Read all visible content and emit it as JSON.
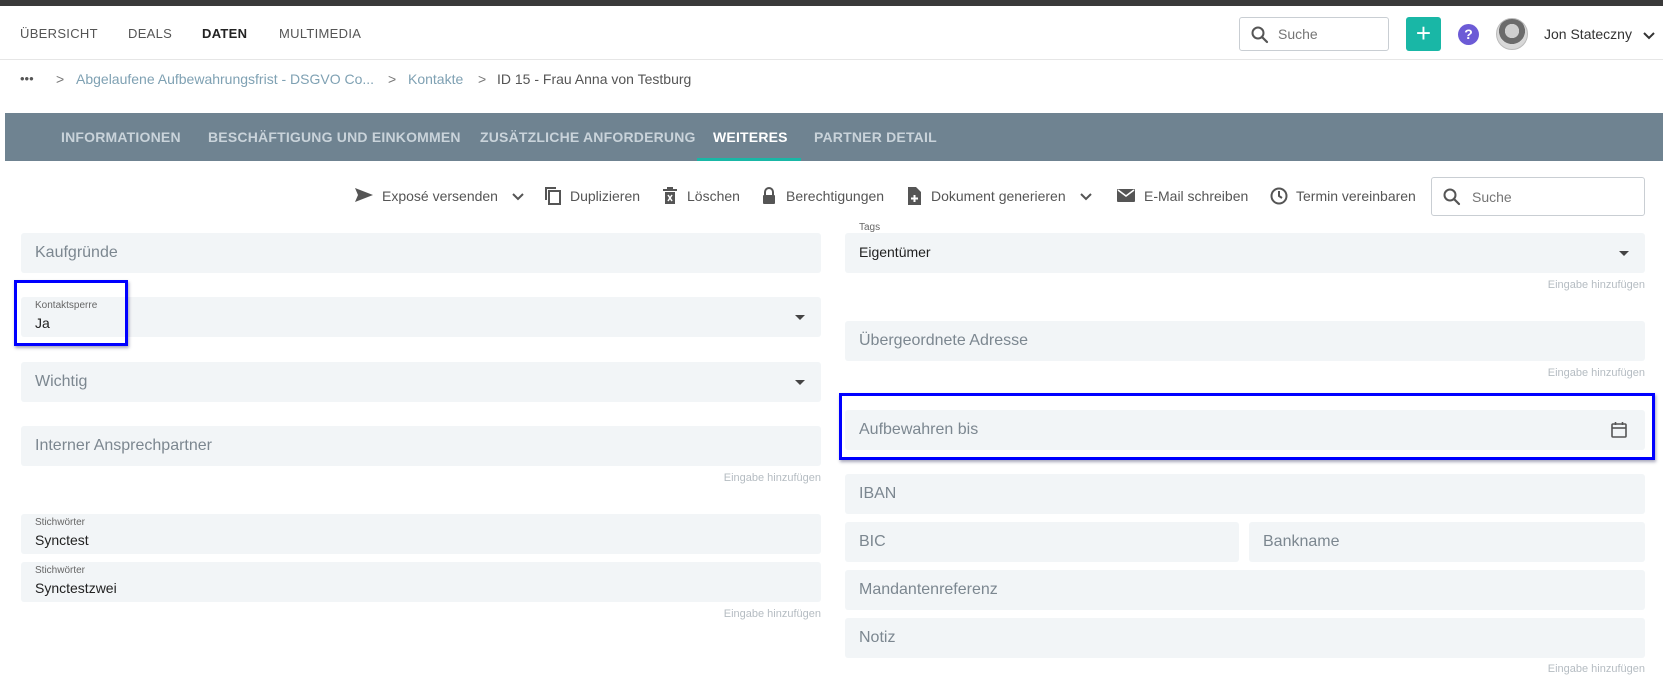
{
  "nav": {
    "items": [
      "ÜBERSICHT",
      "DEALS",
      "DATEN",
      "MULTIMEDIA"
    ],
    "active": "DATEN",
    "search_placeholder": "Suche",
    "add_label": "+",
    "help_label": "?",
    "user_name": "Jon Stateczny"
  },
  "breadcrumb": {
    "more": "•••",
    "sep": ">",
    "items": [
      "Abgelaufene Aufbewahrungsfrist - DSGVO Co...",
      "Kontakte"
    ],
    "current": "ID 15 - Frau Anna von Testburg"
  },
  "tabs": [
    "INFORMATIONEN",
    "BESCHÄFTIGUNG UND EINKOMMEN",
    "ZUSÄTZLICHE ANFORDERUNG",
    "WEITERES",
    "PARTNER DETAIL"
  ],
  "active_tab": "WEITERES",
  "actions": {
    "expose": "Exposé versenden",
    "duplicate": "Duplizieren",
    "delete": "Löschen",
    "permissions": "Berechtigungen",
    "generate_doc": "Dokument generieren",
    "email": "E-Mail schreiben",
    "appointment": "Termin vereinbaren",
    "search_placeholder": "Suche"
  },
  "left_fields": {
    "kaufgruende": "Kaufgründe",
    "kontaktsperre_label": "Kontaktsperre",
    "kontaktsperre_value": "Ja",
    "wichtig": "Wichtig",
    "ansprechpartner": "Interner Ansprechpartner",
    "hint": "Eingabe hinzufügen",
    "keywords_label": "Stichwörter",
    "keywords": [
      "Synctest",
      "Synctestzwei"
    ]
  },
  "right_fields": {
    "tags_label": "Tags",
    "tags_value": "Eigentümer",
    "parent_address": "Übergeordnete Adresse",
    "keep_until": "Aufbewahren bis",
    "iban": "IBAN",
    "bic": "BIC",
    "bank_name": "Bankname",
    "mandate_ref": "Mandantenreferenz",
    "note": "Notiz",
    "hint": "Eingabe hinzufügen"
  },
  "colors": {
    "accent": "#19b7a6",
    "tabbar": "#6f8391",
    "highlight": "#0000ff",
    "help": "#6c5bd6"
  }
}
